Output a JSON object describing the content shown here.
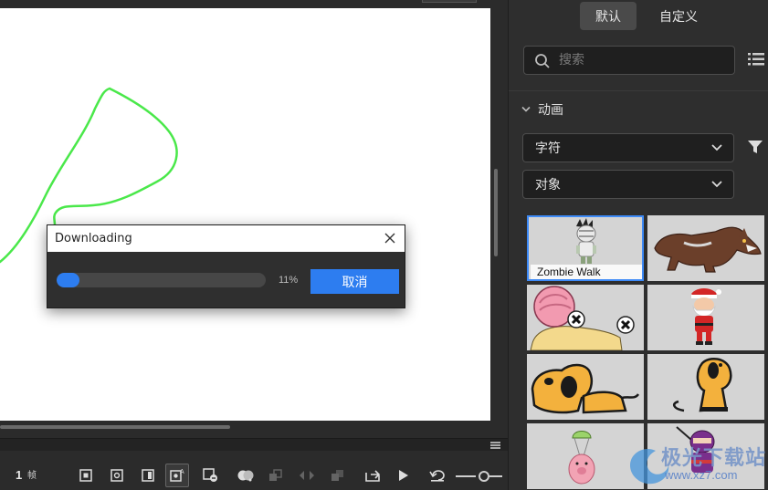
{
  "dialog": {
    "title": "Downloading",
    "progress_fraction": 0.11,
    "progress_text": "11%",
    "cancel_label": "取消"
  },
  "timeline": {
    "frame_number": "1",
    "frame_unit": "帧"
  },
  "panel": {
    "tabs": [
      {
        "label": "默认",
        "active": true
      },
      {
        "label": "自定义",
        "active": false
      }
    ],
    "search": {
      "placeholder": "搜索",
      "value": ""
    },
    "section_title": "动画",
    "dropdowns": [
      {
        "value": "字符"
      },
      {
        "value": "对象"
      }
    ],
    "tiles": [
      {
        "label": "Zombie Walk",
        "selected": true,
        "icon": "zombie-mummy-character"
      },
      {
        "label": "",
        "selected": false,
        "icon": "werewolf-character"
      },
      {
        "label": "",
        "selected": false,
        "icon": "pink-blob-character"
      },
      {
        "label": "",
        "selected": false,
        "icon": "santa-character"
      },
      {
        "label": "",
        "selected": false,
        "icon": "dog-lying-character"
      },
      {
        "label": "",
        "selected": false,
        "icon": "dog-sitting-character"
      },
      {
        "label": "",
        "selected": false,
        "icon": "parachute-pig-character"
      },
      {
        "label": "",
        "selected": false,
        "icon": "ninja-character"
      }
    ]
  },
  "watermark": {
    "text": "极光下载站",
    "url": "www.xz7.com"
  },
  "colors": {
    "accent": "#2d7df0",
    "stroke_green": "#4ae84a",
    "panel_bg": "#2e2e2e",
    "selected_border": "#3d8af7"
  }
}
